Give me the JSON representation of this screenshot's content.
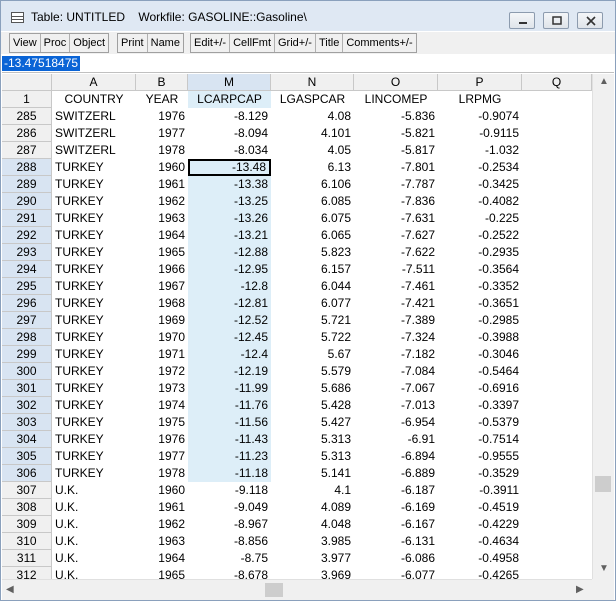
{
  "window": {
    "title": "Table: UNTITLED    Workfile: GASOLINE::Gasoline\\"
  },
  "toolbar": {
    "group1": [
      "View",
      "Proc",
      "Object"
    ],
    "group2": [
      "Print",
      "Name"
    ],
    "group3": [
      "Edit+/-",
      "CellFmt",
      "Grid+/-",
      "Title",
      "Comments+/-"
    ]
  },
  "cell_editor": {
    "value": "-13.47518475"
  },
  "columns": [
    "A",
    "B",
    "M",
    "N",
    "O",
    "P",
    "Q"
  ],
  "header_row": {
    "row_label": "1",
    "values": [
      "COUNTRY",
      "YEAR",
      "LCARPCAP",
      "LGASPCAR",
      "LINCOMEP",
      "LRPMG",
      ""
    ]
  },
  "rows": [
    {
      "n": "285",
      "country": "SWITZERL",
      "year": "1976",
      "m": "-8.129",
      "nv": "4.08",
      "o": "-5.836",
      "p": "-0.9074"
    },
    {
      "n": "286",
      "country": "SWITZERL",
      "year": "1977",
      "m": "-8.094",
      "nv": "4.101",
      "o": "-5.821",
      "p": "-0.9115"
    },
    {
      "n": "287",
      "country": "SWITZERL",
      "year": "1978",
      "m": "-8.034",
      "nv": "4.05",
      "o": "-5.817",
      "p": "-1.032"
    },
    {
      "n": "288",
      "country": "TURKEY",
      "year": "1960",
      "m": "-13.48",
      "nv": "6.13",
      "o": "-7.801",
      "p": "-0.2534"
    },
    {
      "n": "289",
      "country": "TURKEY",
      "year": "1961",
      "m": "-13.38",
      "nv": "6.106",
      "o": "-7.787",
      "p": "-0.3425"
    },
    {
      "n": "290",
      "country": "TURKEY",
      "year": "1962",
      "m": "-13.25",
      "nv": "6.085",
      "o": "-7.836",
      "p": "-0.4082"
    },
    {
      "n": "291",
      "country": "TURKEY",
      "year": "1963",
      "m": "-13.26",
      "nv": "6.075",
      "o": "-7.631",
      "p": "-0.225"
    },
    {
      "n": "292",
      "country": "TURKEY",
      "year": "1964",
      "m": "-13.21",
      "nv": "6.065",
      "o": "-7.627",
      "p": "-0.2522"
    },
    {
      "n": "293",
      "country": "TURKEY",
      "year": "1965",
      "m": "-12.88",
      "nv": "5.823",
      "o": "-7.622",
      "p": "-0.2935"
    },
    {
      "n": "294",
      "country": "TURKEY",
      "year": "1966",
      "m": "-12.95",
      "nv": "6.157",
      "o": "-7.511",
      "p": "-0.3564"
    },
    {
      "n": "295",
      "country": "TURKEY",
      "year": "1967",
      "m": "-12.8",
      "nv": "6.044",
      "o": "-7.461",
      "p": "-0.3352"
    },
    {
      "n": "296",
      "country": "TURKEY",
      "year": "1968",
      "m": "-12.81",
      "nv": "6.077",
      "o": "-7.421",
      "p": "-0.3651"
    },
    {
      "n": "297",
      "country": "TURKEY",
      "year": "1969",
      "m": "-12.52",
      "nv": "5.721",
      "o": "-7.389",
      "p": "-0.2985"
    },
    {
      "n": "298",
      "country": "TURKEY",
      "year": "1970",
      "m": "-12.45",
      "nv": "5.722",
      "o": "-7.324",
      "p": "-0.3988"
    },
    {
      "n": "299",
      "country": "TURKEY",
      "year": "1971",
      "m": "-12.4",
      "nv": "5.67",
      "o": "-7.182",
      "p": "-0.3046"
    },
    {
      "n": "300",
      "country": "TURKEY",
      "year": "1972",
      "m": "-12.19",
      "nv": "5.579",
      "o": "-7.084",
      "p": "-0.5464"
    },
    {
      "n": "301",
      "country": "TURKEY",
      "year": "1973",
      "m": "-11.99",
      "nv": "5.686",
      "o": "-7.067",
      "p": "-0.6916"
    },
    {
      "n": "302",
      "country": "TURKEY",
      "year": "1974",
      "m": "-11.76",
      "nv": "5.428",
      "o": "-7.013",
      "p": "-0.3397"
    },
    {
      "n": "303",
      "country": "TURKEY",
      "year": "1975",
      "m": "-11.56",
      "nv": "5.427",
      "o": "-6.954",
      "p": "-0.5379"
    },
    {
      "n": "304",
      "country": "TURKEY",
      "year": "1976",
      "m": "-11.43",
      "nv": "5.313",
      "o": "-6.91",
      "p": "-0.7514"
    },
    {
      "n": "305",
      "country": "TURKEY",
      "year": "1977",
      "m": "-11.23",
      "nv": "5.313",
      "o": "-6.894",
      "p": "-0.9555"
    },
    {
      "n": "306",
      "country": "TURKEY",
      "year": "1978",
      "m": "-11.18",
      "nv": "5.141",
      "o": "-6.889",
      "p": "-0.3529"
    },
    {
      "n": "307",
      "country": "U.K.",
      "year": "1960",
      "m": "-9.118",
      "nv": "4.1",
      "o": "-6.187",
      "p": "-0.3911"
    },
    {
      "n": "308",
      "country": "U.K.",
      "year": "1961",
      "m": "-9.049",
      "nv": "4.089",
      "o": "-6.169",
      "p": "-0.4519"
    },
    {
      "n": "309",
      "country": "U.K.",
      "year": "1962",
      "m": "-8.967",
      "nv": "4.048",
      "o": "-6.167",
      "p": "-0.4229"
    },
    {
      "n": "310",
      "country": "U.K.",
      "year": "1963",
      "m": "-8.856",
      "nv": "3.985",
      "o": "-6.131",
      "p": "-0.4634"
    },
    {
      "n": "311",
      "country": "U.K.",
      "year": "1964",
      "m": "-8.75",
      "nv": "3.977",
      "o": "-6.086",
      "p": "-0.4958"
    },
    {
      "n": "312",
      "country": "U.K.",
      "year": "1965",
      "m": "-8.678",
      "nv": "3.969",
      "o": "-6.077",
      "p": "-0.4265"
    },
    {
      "n": "313",
      "country": "",
      "year": "",
      "m": "",
      "nv": "",
      "o": "",
      "p": ""
    }
  ],
  "colors": {
    "selection": "#ddeef8",
    "header": "#f0f0f0",
    "accent": "#0a64d6"
  }
}
